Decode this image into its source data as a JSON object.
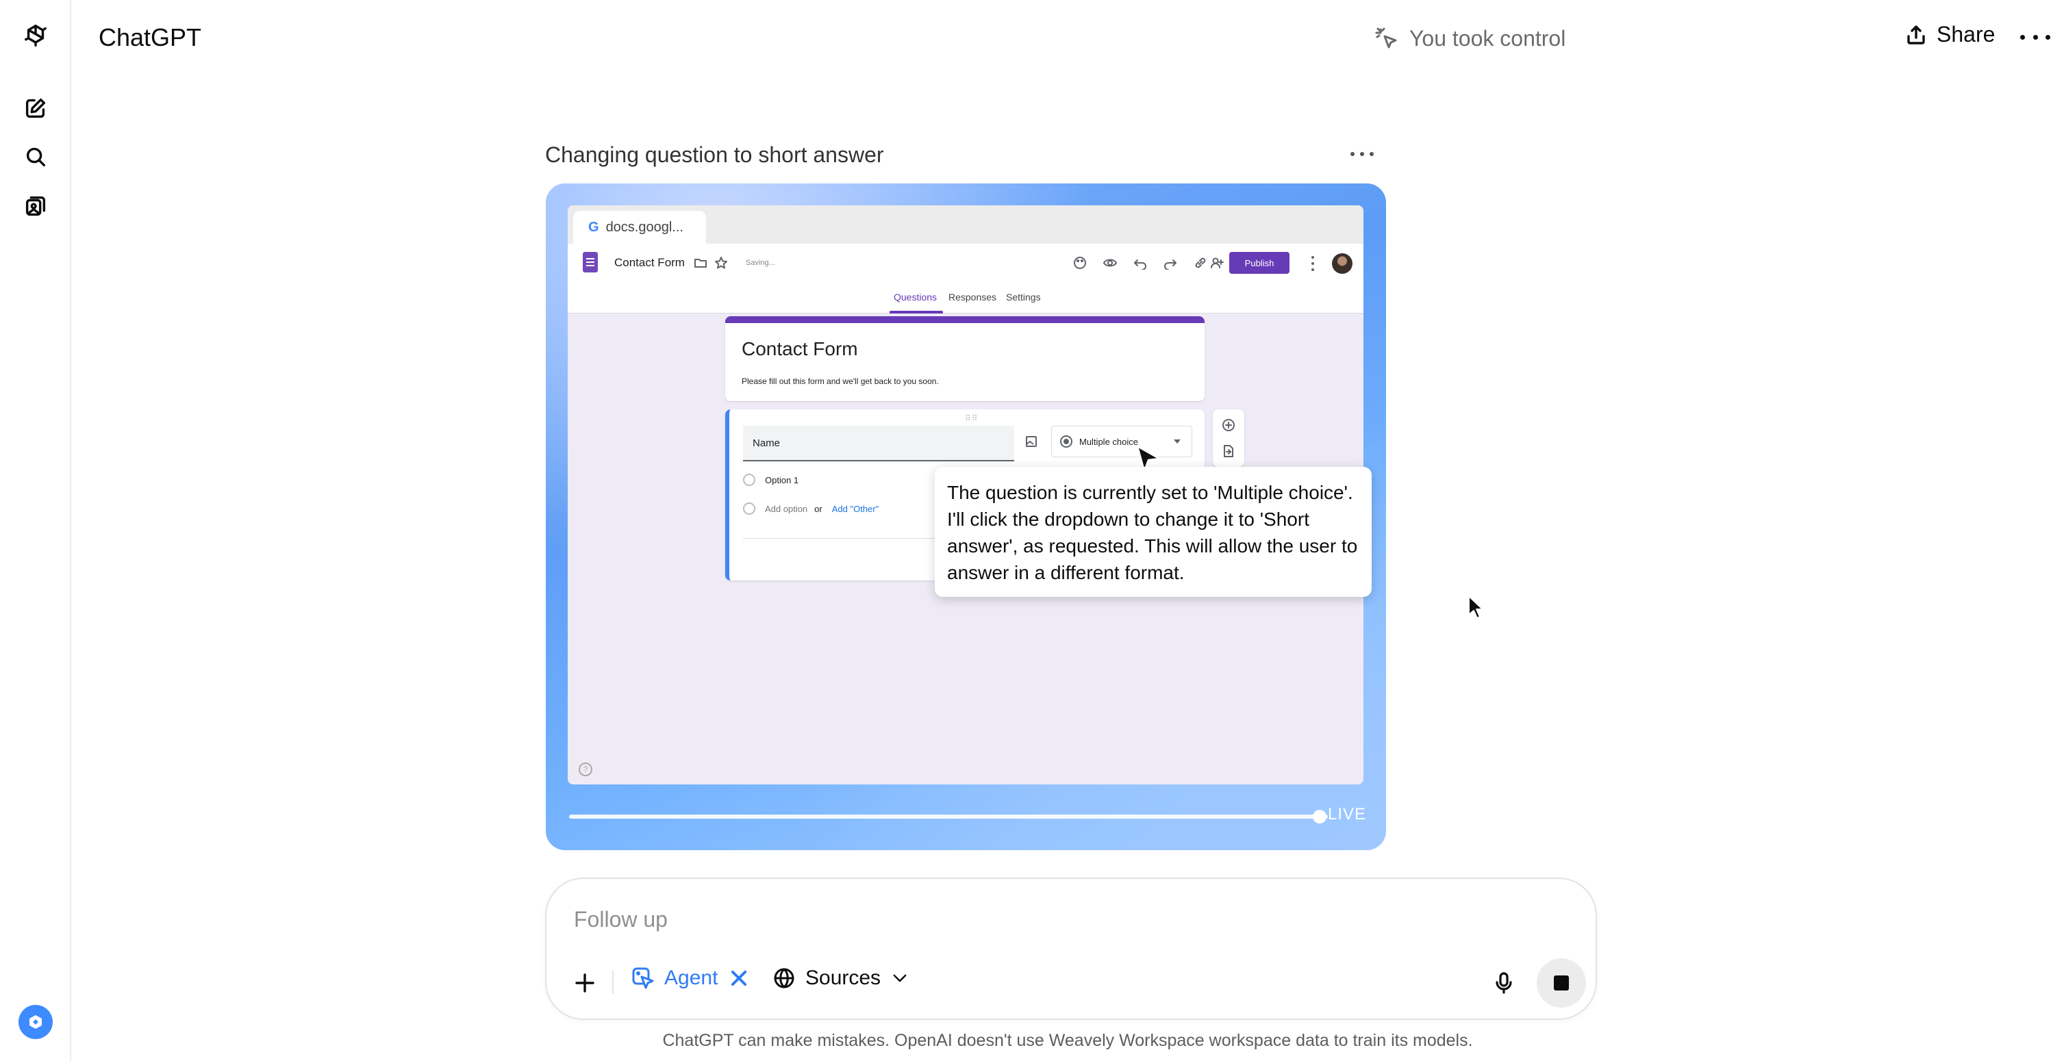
{
  "app": {
    "title": "ChatGPT"
  },
  "header": {
    "status_text": "You took control",
    "share_label": "Share"
  },
  "task": {
    "title": "Changing question to short answer",
    "live_label": "LIVE",
    "progress_fraction": 0.98
  },
  "browser": {
    "tab_title": "docs.googl...",
    "doc_name": "Contact Form",
    "saving_text": "Saving...",
    "publish_label": "Publish",
    "tabs": [
      "Questions",
      "Responses",
      "Settings"
    ],
    "active_tab": "Questions",
    "form": {
      "title": "Contact Form",
      "description": "Please fill out this form and we'll get back to you soon.",
      "question_title": "Name",
      "question_type": "Multiple choice",
      "options": [
        "Option 1"
      ],
      "add_option": "Add option",
      "or_text": "or",
      "add_other": "Add \"Other\""
    }
  },
  "tooltip": {
    "text": "The question is currently set to 'Multiple choice'. I'll click the dropdown to change it to 'Short answer', as requested. This will allow the user to answer in a different format."
  },
  "composer": {
    "placeholder": "Follow up",
    "agent_label": "Agent",
    "sources_label": "Sources"
  },
  "footer": {
    "disclaimer": "ChatGPT can make mistakes. OpenAI doesn't use Weavely Workspace workspace data to train its models."
  },
  "colors": {
    "accent_blue": "#2f7bf5",
    "forms_purple": "#673ab7",
    "badge_blue": "#3e8bff"
  },
  "icons": {
    "sidebar": [
      "openai-logo-icon",
      "new-chat-icon",
      "search-icon",
      "library-icon",
      "help-badge-icon"
    ],
    "header": [
      "cursor-sparkle-icon",
      "share-icon",
      "more-icon"
    ],
    "composer": [
      "plus-icon",
      "agent-icon",
      "close-icon",
      "globe-icon",
      "chevron-down-icon",
      "microphone-icon",
      "stop-icon"
    ]
  }
}
